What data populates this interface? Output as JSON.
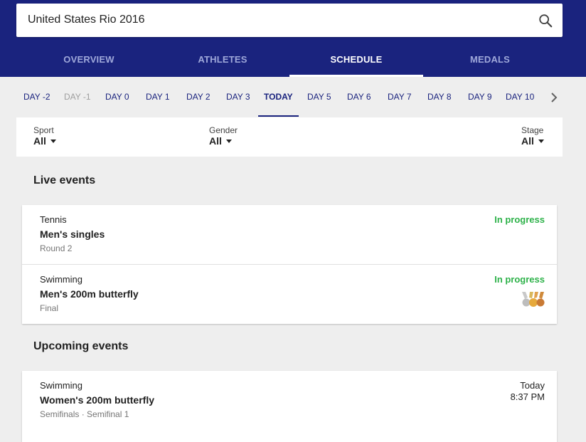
{
  "search": {
    "query": "United States Rio 2016"
  },
  "tabs": [
    {
      "label": "OVERVIEW"
    },
    {
      "label": "ATHLETES"
    },
    {
      "label": "SCHEDULE"
    },
    {
      "label": "MEDALS"
    }
  ],
  "active_tab": "SCHEDULE",
  "days": [
    {
      "label": "DAY -2",
      "state": "normal"
    },
    {
      "label": "DAY -1",
      "state": "disabled"
    },
    {
      "label": "DAY 0",
      "state": "normal"
    },
    {
      "label": "DAY 1",
      "state": "normal"
    },
    {
      "label": "DAY 2",
      "state": "normal"
    },
    {
      "label": "DAY 3",
      "state": "normal"
    },
    {
      "label": "TODAY",
      "state": "active"
    },
    {
      "label": "DAY 5",
      "state": "normal"
    },
    {
      "label": "DAY 6",
      "state": "normal"
    },
    {
      "label": "DAY 7",
      "state": "normal"
    },
    {
      "label": "DAY 8",
      "state": "normal"
    },
    {
      "label": "DAY 9",
      "state": "normal"
    },
    {
      "label": "DAY 10",
      "state": "normal"
    }
  ],
  "filters": {
    "sport": {
      "label": "Sport",
      "value": "All"
    },
    "gender": {
      "label": "Gender",
      "value": "All"
    },
    "stage": {
      "label": "Stage",
      "value": "All"
    }
  },
  "live": {
    "title": "Live events",
    "events": [
      {
        "sport": "Tennis",
        "name": "Men's singles",
        "round": "Round 2",
        "status": "In progress"
      },
      {
        "sport": "Swimming",
        "name": "Men's 200m butterfly",
        "round": "Final",
        "status": "In progress",
        "icon": "medals-icon"
      }
    ]
  },
  "upcoming": {
    "title": "Upcoming events",
    "events": [
      {
        "sport": "Swimming",
        "name": "Women's 200m butterfly",
        "round": "Semifinals · Semifinal 1",
        "day": "Today",
        "time": "8:37 PM"
      }
    ]
  },
  "colors": {
    "header": "#1a237e",
    "in_progress": "#2eb24a",
    "tab_inactive": "#9fa8da",
    "day_link": "#1a237e"
  }
}
